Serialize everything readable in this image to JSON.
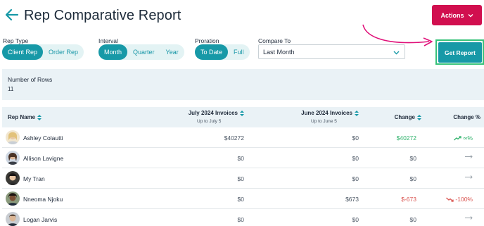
{
  "header": {
    "title": "Rep Comparative Report",
    "actions_label": "Actions"
  },
  "filters": {
    "rep_type": {
      "label": "Rep Type",
      "options": [
        "Client Rep",
        "Order Rep"
      ],
      "selected": "Client Rep"
    },
    "interval": {
      "label": "Interval",
      "options": [
        "Month",
        "Quarter",
        "Year"
      ],
      "selected": "Month"
    },
    "proration": {
      "label": "Proration",
      "options": [
        "To Date",
        "Full"
      ],
      "selected": "To Date"
    },
    "compare_to": {
      "label": "Compare To",
      "value": "Last Month"
    },
    "get_report_label": "Get Report"
  },
  "summary": {
    "rows_label": "Number of Rows",
    "rows_value": "11"
  },
  "table": {
    "columns": {
      "rep_name": "Rep Name",
      "july": "July 2024 Invoices",
      "july_sub": "Up to July 5",
      "june": "June 2024 Invoices",
      "june_sub": "Up to June 5",
      "change": "Change",
      "change_pct": "Change %"
    },
    "rows": [
      {
        "name": "Ashley Colautti",
        "july": "$40272",
        "june": "$0",
        "change": "$40272",
        "change_pct": "∞%",
        "trend": "up"
      },
      {
        "name": "Allison Lavigne",
        "july": "$0",
        "june": "$0",
        "change": "$0",
        "change_pct": "",
        "trend": "flat"
      },
      {
        "name": "My Tran",
        "july": "$0",
        "june": "$0",
        "change": "$0",
        "change_pct": "",
        "trend": "flat"
      },
      {
        "name": "Nneoma Njoku",
        "july": "$0",
        "june": "$673",
        "change": "$-673",
        "change_pct": "-100%",
        "trend": "down"
      },
      {
        "name": "Logan Jarvis",
        "july": "$0",
        "june": "$0",
        "change": "$0",
        "change_pct": "",
        "trend": "flat"
      }
    ]
  },
  "colors": {
    "accent": "#1799a7",
    "actions": "#d10f4f",
    "highlight": "#36c27a",
    "positive": "#2fb26b",
    "negative": "#d9534f"
  }
}
